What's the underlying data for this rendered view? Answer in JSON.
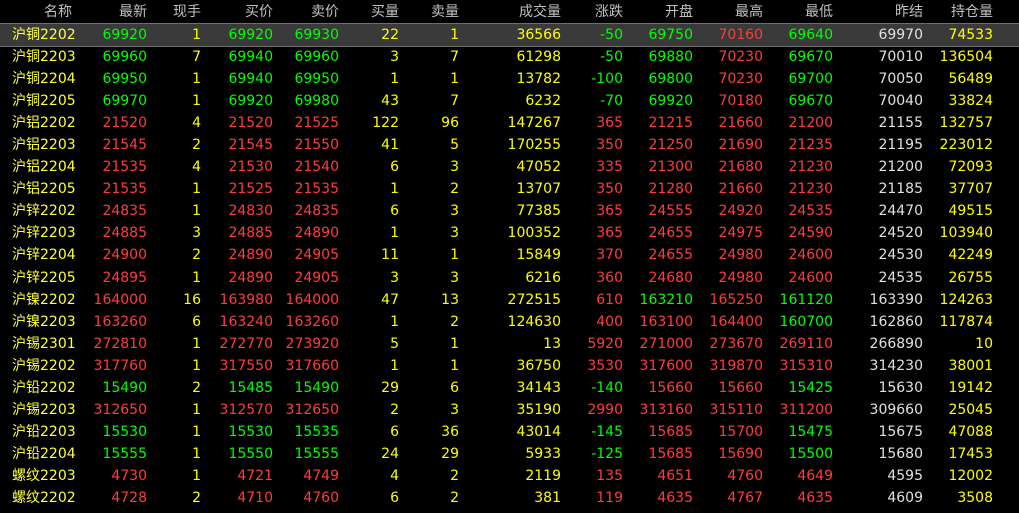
{
  "columns": {
    "name": "名称",
    "last": "最新",
    "vol_now": "现手",
    "bid": "买价",
    "ask": "卖价",
    "bid_qty": "买量",
    "ask_qty": "卖量",
    "volume": "成交量",
    "change": "涨跌",
    "open": "开盘",
    "high": "最高",
    "low": "最低",
    "prev_settle": "昨结",
    "oi": "持仓量"
  },
  "colors": {
    "up": "#ff3c3c",
    "down": "#00ff00",
    "flat": "#e0e0e0",
    "qty": "#ffff00",
    "name": "#ffff3c",
    "header": "#c0c0c0"
  },
  "selected_row": 0,
  "rows": [
    {
      "name": "沪铜2202",
      "last": "69920",
      "vol_now": "1",
      "bid": "69920",
      "ask": "69930",
      "bid_qty": "22",
      "ask_qty": "1",
      "volume": "36566",
      "change": "-50",
      "open": "69750",
      "high": "70160",
      "low": "69640",
      "prev": "69970",
      "oi": "74533"
    },
    {
      "name": "沪铜2203",
      "last": "69960",
      "vol_now": "7",
      "bid": "69940",
      "ask": "69960",
      "bid_qty": "3",
      "ask_qty": "7",
      "volume": "61298",
      "change": "-50",
      "open": "69880",
      "high": "70230",
      "low": "69670",
      "prev": "70010",
      "oi": "136504"
    },
    {
      "name": "沪铜2204",
      "last": "69950",
      "vol_now": "1",
      "bid": "69940",
      "ask": "69950",
      "bid_qty": "1",
      "ask_qty": "1",
      "volume": "13782",
      "change": "-100",
      "open": "69800",
      "high": "70230",
      "low": "69700",
      "prev": "70050",
      "oi": "56489"
    },
    {
      "name": "沪铜2205",
      "last": "69970",
      "vol_now": "1",
      "bid": "69920",
      "ask": "69980",
      "bid_qty": "43",
      "ask_qty": "7",
      "volume": "6232",
      "change": "-70",
      "open": "69920",
      "high": "70180",
      "low": "69670",
      "prev": "70040",
      "oi": "33824"
    },
    {
      "name": "沪铝2202",
      "last": "21520",
      "vol_now": "4",
      "bid": "21520",
      "ask": "21525",
      "bid_qty": "122",
      "ask_qty": "96",
      "volume": "147267",
      "change": "365",
      "open": "21215",
      "high": "21660",
      "low": "21200",
      "prev": "21155",
      "oi": "132757"
    },
    {
      "name": "沪铝2203",
      "last": "21545",
      "vol_now": "2",
      "bid": "21545",
      "ask": "21550",
      "bid_qty": "41",
      "ask_qty": "5",
      "volume": "170255",
      "change": "350",
      "open": "21250",
      "high": "21690",
      "low": "21235",
      "prev": "21195",
      "oi": "223012"
    },
    {
      "name": "沪铝2204",
      "last": "21535",
      "vol_now": "4",
      "bid": "21530",
      "ask": "21540",
      "bid_qty": "6",
      "ask_qty": "3",
      "volume": "47052",
      "change": "335",
      "open": "21300",
      "high": "21680",
      "low": "21230",
      "prev": "21200",
      "oi": "72093"
    },
    {
      "name": "沪铝2205",
      "last": "21535",
      "vol_now": "1",
      "bid": "21525",
      "ask": "21535",
      "bid_qty": "1",
      "ask_qty": "2",
      "volume": "13707",
      "change": "350",
      "open": "21280",
      "high": "21660",
      "low": "21230",
      "prev": "21185",
      "oi": "37707"
    },
    {
      "name": "沪锌2202",
      "last": "24835",
      "vol_now": "1",
      "bid": "24830",
      "ask": "24835",
      "bid_qty": "6",
      "ask_qty": "3",
      "volume": "77385",
      "change": "365",
      "open": "24555",
      "high": "24920",
      "low": "24535",
      "prev": "24470",
      "oi": "49515"
    },
    {
      "name": "沪锌2203",
      "last": "24885",
      "vol_now": "3",
      "bid": "24885",
      "ask": "24890",
      "bid_qty": "1",
      "ask_qty": "3",
      "volume": "100352",
      "change": "365",
      "open": "24655",
      "high": "24975",
      "low": "24590",
      "prev": "24520",
      "oi": "103940"
    },
    {
      "name": "沪锌2204",
      "last": "24900",
      "vol_now": "2",
      "bid": "24890",
      "ask": "24905",
      "bid_qty": "11",
      "ask_qty": "1",
      "volume": "15849",
      "change": "370",
      "open": "24655",
      "high": "24980",
      "low": "24600",
      "prev": "24530",
      "oi": "42249"
    },
    {
      "name": "沪锌2205",
      "last": "24895",
      "vol_now": "1",
      "bid": "24890",
      "ask": "24905",
      "bid_qty": "3",
      "ask_qty": "3",
      "volume": "6216",
      "change": "360",
      "open": "24680",
      "high": "24980",
      "low": "24600",
      "prev": "24535",
      "oi": "26755"
    },
    {
      "name": "沪镍2202",
      "last": "164000",
      "vol_now": "16",
      "bid": "163980",
      "ask": "164000",
      "bid_qty": "47",
      "ask_qty": "13",
      "volume": "272515",
      "change": "610",
      "open": "163210",
      "high": "165250",
      "low": "161120",
      "prev": "163390",
      "oi": "124263"
    },
    {
      "name": "沪镍2203",
      "last": "163260",
      "vol_now": "6",
      "bid": "163240",
      "ask": "163260",
      "bid_qty": "1",
      "ask_qty": "2",
      "volume": "124630",
      "change": "400",
      "open": "163100",
      "high": "164400",
      "low": "160700",
      "prev": "162860",
      "oi": "117874"
    },
    {
      "name": "沪锡2301",
      "last": "272810",
      "vol_now": "1",
      "bid": "272770",
      "ask": "273920",
      "bid_qty": "5",
      "ask_qty": "1",
      "volume": "13",
      "change": "5920",
      "open": "271000",
      "high": "273670",
      "low": "269110",
      "prev": "266890",
      "oi": "10"
    },
    {
      "name": "沪锡2202",
      "last": "317760",
      "vol_now": "1",
      "bid": "317550",
      "ask": "317660",
      "bid_qty": "1",
      "ask_qty": "1",
      "volume": "36750",
      "change": "3530",
      "open": "317600",
      "high": "319870",
      "low": "315310",
      "prev": "314230",
      "oi": "38001"
    },
    {
      "name": "沪铅2202",
      "last": "15490",
      "vol_now": "2",
      "bid": "15485",
      "ask": "15490",
      "bid_qty": "29",
      "ask_qty": "6",
      "volume": "34143",
      "change": "-140",
      "open": "15660",
      "high": "15660",
      "low": "15425",
      "prev": "15630",
      "oi": "19142"
    },
    {
      "name": "沪锡2203",
      "last": "312650",
      "vol_now": "1",
      "bid": "312570",
      "ask": "312650",
      "bid_qty": "2",
      "ask_qty": "3",
      "volume": "35190",
      "change": "2990",
      "open": "313160",
      "high": "315110",
      "low": "311200",
      "prev": "309660",
      "oi": "25045"
    },
    {
      "name": "沪铅2203",
      "last": "15530",
      "vol_now": "1",
      "bid": "15530",
      "ask": "15535",
      "bid_qty": "6",
      "ask_qty": "36",
      "volume": "43014",
      "change": "-145",
      "open": "15685",
      "high": "15700",
      "low": "15475",
      "prev": "15675",
      "oi": "47088"
    },
    {
      "name": "沪铅2204",
      "last": "15555",
      "vol_now": "1",
      "bid": "15550",
      "ask": "15555",
      "bid_qty": "24",
      "ask_qty": "29",
      "volume": "5933",
      "change": "-125",
      "open": "15685",
      "high": "15690",
      "low": "15500",
      "prev": "15680",
      "oi": "17453"
    },
    {
      "name": "螺纹2203",
      "last": "4730",
      "vol_now": "1",
      "bid": "4721",
      "ask": "4749",
      "bid_qty": "4",
      "ask_qty": "2",
      "volume": "2119",
      "change": "135",
      "open": "4651",
      "high": "4760",
      "low": "4649",
      "prev": "4595",
      "oi": "12002"
    },
    {
      "name": "螺纹2202",
      "last": "4728",
      "vol_now": "2",
      "bid": "4710",
      "ask": "4760",
      "bid_qty": "6",
      "ask_qty": "2",
      "volume": "381",
      "change": "119",
      "open": "4635",
      "high": "4767",
      "low": "4635",
      "prev": "4609",
      "oi": "3508"
    }
  ]
}
